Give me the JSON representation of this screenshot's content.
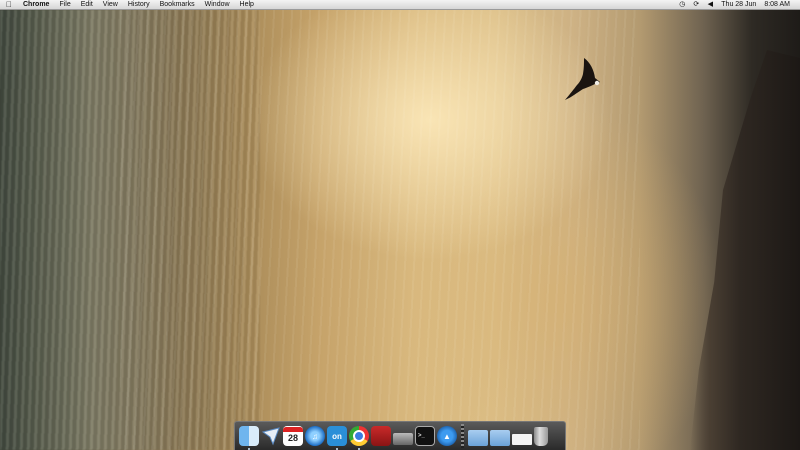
{
  "menubar": {
    "apple_icon": "apple-icon",
    "app_name": "Chrome",
    "menus": [
      "File",
      "Edit",
      "View",
      "History",
      "Bookmarks",
      "Window",
      "Help"
    ],
    "status_icons": [
      "time-machine-icon",
      "sync-icon",
      "volume-icon"
    ],
    "date": "Thu 28 Jun",
    "time": "8:08 AM"
  },
  "dock": {
    "items": [
      {
        "name": "finder-icon",
        "running": true
      },
      {
        "name": "mail-icon",
        "running": false
      },
      {
        "name": "calendar-icon",
        "label": "28",
        "running": false
      },
      {
        "name": "itunes-icon",
        "running": false
      },
      {
        "name": "on-app-icon",
        "label": "on",
        "running": true
      },
      {
        "name": "chrome-icon",
        "running": true
      },
      {
        "name": "book-icon",
        "running": false
      },
      {
        "name": "scanner-icon",
        "running": false
      },
      {
        "name": "terminal-icon",
        "label": ">_",
        "running": false
      },
      {
        "name": "app-store-icon",
        "running": false
      },
      {
        "name": "applications-folder-icon",
        "running": false
      },
      {
        "name": "documents-folder-icon",
        "running": false
      },
      {
        "name": "document-preview-icon",
        "running": false
      },
      {
        "name": "trash-icon",
        "running": false
      }
    ]
  },
  "colors": {
    "menubar_bg": "#e6e6e6",
    "running_indicator": "#cfe9ff"
  }
}
